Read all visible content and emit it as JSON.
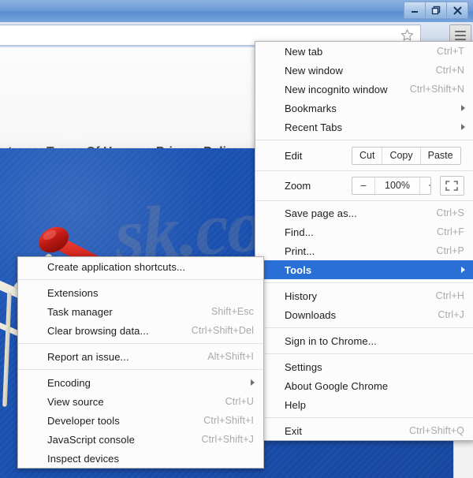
{
  "window": {
    "controls": [
      {
        "name": "minimize",
        "glyph": "—"
      },
      {
        "name": "restore",
        "glyph": "❐"
      },
      {
        "name": "close",
        "glyph": "✕"
      }
    ]
  },
  "toolbar": {
    "address_value": "",
    "address_placeholder": "",
    "bookmark_icon": "star-icon",
    "menu_icon": "hamburger-icon"
  },
  "page": {
    "nav_links": [
      "out",
      "Terms Of Use",
      "Privacy Policy"
    ],
    "watermark": "sk.com",
    "hero_image": "shopping-cart-graphic"
  },
  "main_menu": {
    "items": [
      {
        "label": "New tab",
        "accel": "Ctrl+T",
        "type": "item"
      },
      {
        "label": "New window",
        "accel": "Ctrl+N",
        "type": "item"
      },
      {
        "label": "New incognito window",
        "accel": "Ctrl+Shift+N",
        "type": "item"
      },
      {
        "label": "Bookmarks",
        "accel": "",
        "type": "submenu"
      },
      {
        "label": "Recent Tabs",
        "accel": "",
        "type": "submenu"
      },
      {
        "type": "separator"
      },
      {
        "label": "Edit",
        "type": "edit-row",
        "buttons": [
          "Cut",
          "Copy",
          "Paste"
        ]
      },
      {
        "type": "separator"
      },
      {
        "label": "Zoom",
        "type": "zoom-row",
        "minus": "–",
        "value": "100%",
        "plus": "+",
        "fullscreen_icon": "fullscreen-icon"
      },
      {
        "type": "separator"
      },
      {
        "label": "Save page as...",
        "accel": "Ctrl+S",
        "type": "item"
      },
      {
        "label": "Find...",
        "accel": "Ctrl+F",
        "type": "item"
      },
      {
        "label": "Print...",
        "accel": "Ctrl+P",
        "type": "item"
      },
      {
        "label": "Tools",
        "accel": "",
        "type": "submenu",
        "highlighted": true
      },
      {
        "type": "separator"
      },
      {
        "label": "History",
        "accel": "Ctrl+H",
        "type": "item"
      },
      {
        "label": "Downloads",
        "accel": "Ctrl+J",
        "type": "item"
      },
      {
        "type": "separator"
      },
      {
        "label": "Sign in to Chrome...",
        "accel": "",
        "type": "item"
      },
      {
        "type": "separator"
      },
      {
        "label": "Settings",
        "accel": "",
        "type": "item"
      },
      {
        "label": "About Google Chrome",
        "accel": "",
        "type": "item"
      },
      {
        "label": "Help",
        "accel": "",
        "type": "item"
      },
      {
        "type": "separator"
      },
      {
        "label": "Exit",
        "accel": "Ctrl+Shift+Q",
        "type": "item"
      }
    ]
  },
  "tools_submenu": {
    "items": [
      {
        "label": "Create application shortcuts...",
        "accel": "",
        "type": "item"
      },
      {
        "type": "separator"
      },
      {
        "label": "Extensions",
        "accel": "",
        "type": "item"
      },
      {
        "label": "Task manager",
        "accel": "Shift+Esc",
        "type": "item"
      },
      {
        "label": "Clear browsing data...",
        "accel": "Ctrl+Shift+Del",
        "type": "item"
      },
      {
        "type": "separator"
      },
      {
        "label": "Report an issue...",
        "accel": "Alt+Shift+I",
        "type": "item"
      },
      {
        "type": "separator"
      },
      {
        "label": "Encoding",
        "accel": "",
        "type": "submenu"
      },
      {
        "label": "View source",
        "accel": "Ctrl+U",
        "type": "item"
      },
      {
        "label": "Developer tools",
        "accel": "Ctrl+Shift+I",
        "type": "item"
      },
      {
        "label": "JavaScript console",
        "accel": "Ctrl+Shift+J",
        "type": "item"
      },
      {
        "label": "Inspect devices",
        "accel": "",
        "type": "item"
      }
    ]
  },
  "colors": {
    "highlight": "#2a6fd6",
    "titlebar": "#6c9bd8",
    "hero": "#1a4fae",
    "accel_text": "#a9a9a9"
  }
}
